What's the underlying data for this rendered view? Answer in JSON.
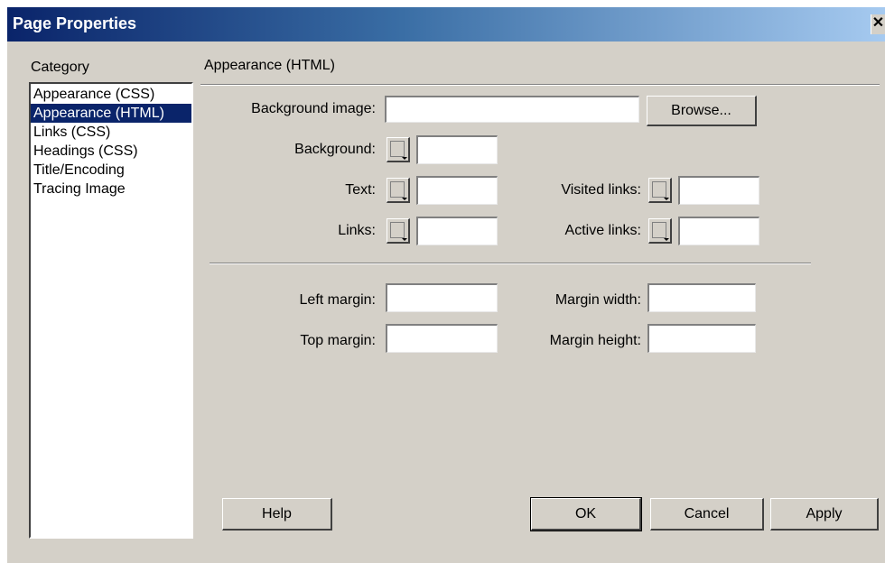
{
  "window": {
    "title": "Page Properties",
    "close_glyph": "✕"
  },
  "category": {
    "label": "Category",
    "items": [
      {
        "label": "Appearance (CSS)",
        "selected": false
      },
      {
        "label": "Appearance (HTML)",
        "selected": true
      },
      {
        "label": "Links (CSS)",
        "selected": false
      },
      {
        "label": "Headings (CSS)",
        "selected": false
      },
      {
        "label": "Title/Encoding",
        "selected": false
      },
      {
        "label": "Tracing Image",
        "selected": false
      }
    ]
  },
  "section": {
    "title": "Appearance (HTML)"
  },
  "fields": {
    "background_image": {
      "label": "Background image:",
      "value": "",
      "browse_label": "Browse..."
    },
    "background": {
      "label": "Background:",
      "value": ""
    },
    "text": {
      "label": "Text:",
      "value": ""
    },
    "visited_links": {
      "label": "Visited links:",
      "value": ""
    },
    "links": {
      "label": "Links:",
      "value": ""
    },
    "active_links": {
      "label": "Active links:",
      "value": ""
    },
    "left_margin": {
      "label": "Left margin:",
      "value": ""
    },
    "margin_width": {
      "label": "Margin width:",
      "value": ""
    },
    "top_margin": {
      "label": "Top margin:",
      "value": ""
    },
    "margin_height": {
      "label": "Margin height:",
      "value": ""
    }
  },
  "buttons": {
    "help": "Help",
    "ok": "OK",
    "cancel": "Cancel",
    "apply": "Apply"
  },
  "colors": {
    "titlebar_start": "#0a246a",
    "titlebar_end": "#a6caf0",
    "selection": "#0a246a",
    "face": "#d4d0c8"
  }
}
